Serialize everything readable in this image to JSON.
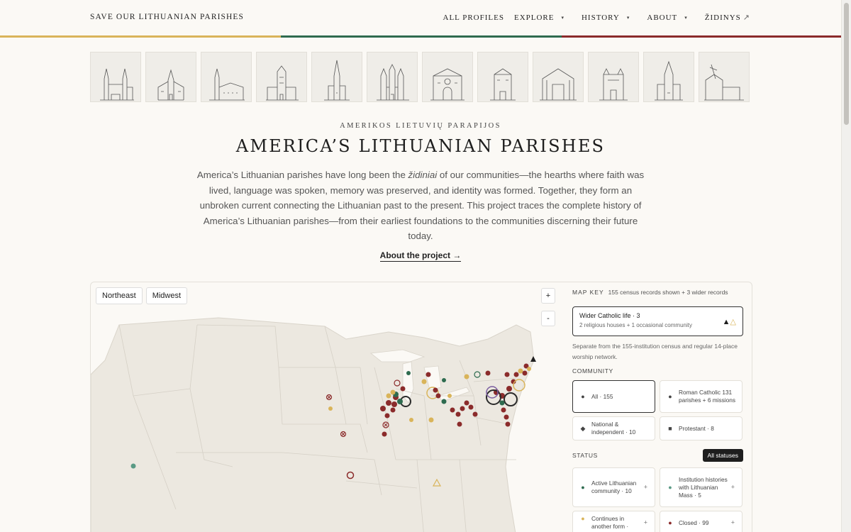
{
  "header": {
    "brand": "SAVE OUR LITHUANIAN PARISHES",
    "nav": {
      "all_profiles": "ALL PROFILES",
      "explore": "EXPLORE",
      "history": "HISTORY",
      "about": "ABOUT",
      "zidinys": "ŽIDINYS",
      "caret": "▾",
      "external": "↗"
    }
  },
  "colors": {
    "gold": "#d9b45a",
    "green": "#2e6b4f",
    "red": "#8b2b2b",
    "background": "#fbf9f5",
    "land": "#ece8e0"
  },
  "hero": {
    "eyebrow": "AMERIKOS LIETUVIŲ PARAPIJOS",
    "title": "AMERICA’S LITHUANIAN PARISHES",
    "intro_before": "America’s Lithuanian parishes have long been the ",
    "intro_em": "židiniai",
    "intro_after": " of our communities—the hearths where faith was lived, language was spoken, memory was preserved, and identity was formed. Together, they form an unbroken current connecting the Lithuanian past to the present. This project traces the complete history of America’s Lithuanian parishes—from their earliest foundations to the communities discerning their future today.",
    "about_link": "About the project →"
  },
  "map": {
    "region_buttons": [
      "Northeast",
      "Midwest"
    ],
    "zoom_in": "+",
    "zoom_out": "-"
  },
  "key": {
    "label": "MAP KEY",
    "records": "155 census records shown + 3 wider records",
    "wider_title": "Wider Catholic life · 3",
    "wider_sub": "2 religious houses + 1 occasional community",
    "wider_icons": "▲△",
    "wider_note": "Separate from the 155-institution census and regular 14-place worship network.",
    "community_label": "COMMUNITY",
    "community": {
      "all": "All · 155",
      "roman": "Roman Catholic 131 parishes + 6 missions",
      "national": "National & independent · 10",
      "protestant": "Protestant · 8"
    },
    "status_label": "STATUS",
    "all_statuses": "All statuses",
    "status": {
      "active": "Active Lithuanian community · 10",
      "histories": "Institution histories with Lithuanian Mass · 5",
      "continues": "Continues in another form ·",
      "closed": "Closed · 99"
    },
    "plus": "+"
  }
}
